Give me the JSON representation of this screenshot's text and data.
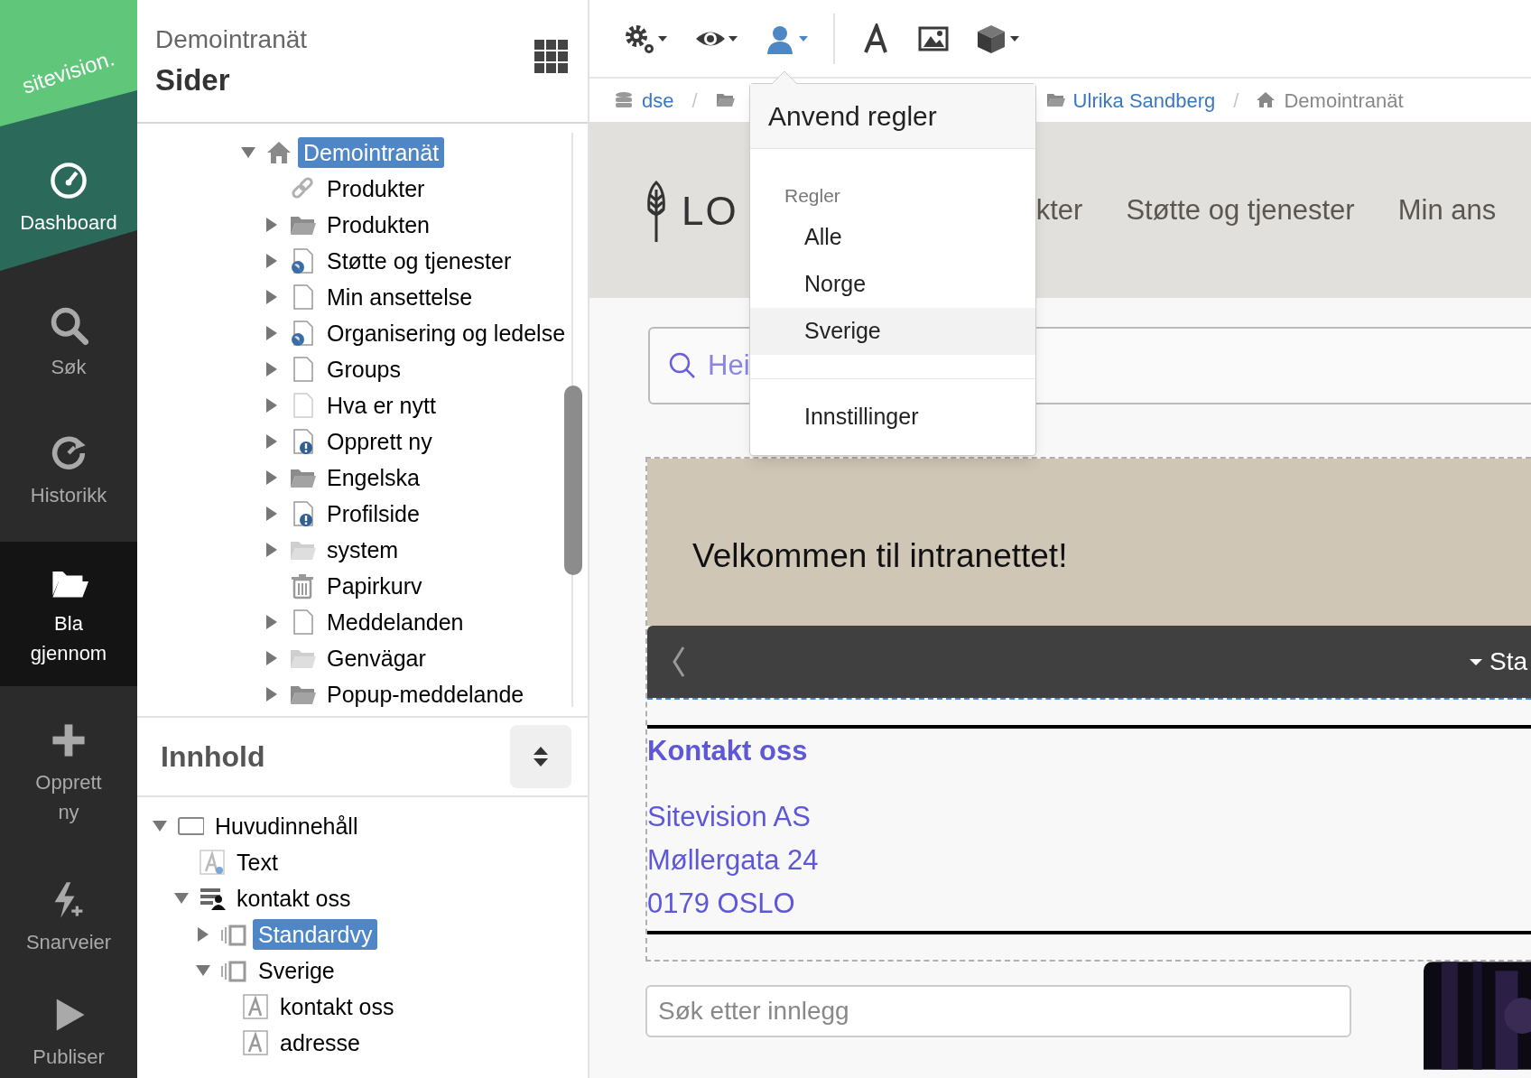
{
  "rail": {
    "logo": "sitevision.",
    "items": [
      {
        "label": "Dashboard",
        "selected": false
      },
      {
        "label": "Søk",
        "selected": false
      },
      {
        "label": "Historikk",
        "selected": false
      },
      {
        "label": "Bla gjennom",
        "selected": true
      },
      {
        "label": "Opprett ny",
        "selected": false
      },
      {
        "label": "Snarveier",
        "selected": false
      },
      {
        "label": "Publiser",
        "selected": false
      }
    ]
  },
  "pages_panel": {
    "site": "Demointranät",
    "title": "Sider",
    "tree": [
      {
        "label": "Demointranät",
        "kind": "home",
        "expanded": true,
        "selected": true,
        "children": [
          {
            "label": "Produkter",
            "kind": "link",
            "selected": false
          },
          {
            "label": "Produkten",
            "kind": "folder",
            "expanded": false,
            "selected": false
          },
          {
            "label": "Støtte og tjenester",
            "kind": "webpage",
            "expanded": false,
            "selected": false
          },
          {
            "label": "Min ansettelse",
            "kind": "page",
            "expanded": false,
            "selected": false
          },
          {
            "label": "Organisering og ledelse",
            "kind": "webpage",
            "expanded": false,
            "selected": false
          },
          {
            "label": "Groups",
            "kind": "page",
            "expanded": false,
            "selected": false
          },
          {
            "label": "Hva er nytt",
            "kind": "unpublished",
            "expanded": false,
            "selected": false
          },
          {
            "label": "Opprett ny",
            "kind": "alert",
            "expanded": false,
            "selected": false
          },
          {
            "label": "Engelska",
            "kind": "folder",
            "expanded": false,
            "selected": false
          },
          {
            "label": "Profilside",
            "kind": "alert",
            "expanded": false,
            "selected": false
          },
          {
            "label": "system",
            "kind": "archive",
            "expanded": false,
            "selected": false
          },
          {
            "label": "Papirkurv",
            "kind": "trash",
            "selected": false
          },
          {
            "label": "Meddelanden",
            "kind": "page",
            "expanded": false,
            "selected": false
          },
          {
            "label": "Genvägar",
            "kind": "archive",
            "expanded": false,
            "selected": false
          },
          {
            "label": "Popup-meddelande",
            "kind": "folder",
            "expanded": false,
            "selected": false
          }
        ]
      }
    ]
  },
  "content_panel": {
    "title": "Innhold",
    "tree": [
      {
        "label": "Huvudinnehåll",
        "kind": "area",
        "expanded": true,
        "selected": false,
        "children": [
          {
            "label": "Text",
            "kind": "newtext",
            "selected": false
          },
          {
            "label": "kontakt oss",
            "kind": "portlet",
            "expanded": true,
            "selected": false,
            "children": [
              {
                "label": "Standardvy",
                "kind": "view",
                "expanded": false,
                "selected": true
              },
              {
                "label": "Sverige",
                "kind": "view",
                "expanded": true,
                "selected": false,
                "children": [
                  {
                    "label": "kontakt oss",
                    "kind": "text",
                    "selected": false
                  },
                  {
                    "label": "adresse",
                    "kind": "text",
                    "selected": false
                  }
                ]
              }
            ]
          }
        ]
      }
    ]
  },
  "toolbar": [
    {
      "dropdown": true,
      "active": false
    },
    {
      "dropdown": true,
      "active": false
    },
    {
      "dropdown": true,
      "active": true
    },
    {
      "dropdown": false,
      "active": false
    },
    {
      "dropdown": false,
      "active": false
    },
    {
      "dropdown": true,
      "active": false
    }
  ],
  "breadcrumb": [
    {
      "label": "dse",
      "kind": "database",
      "link": true
    },
    {
      "kind": "folder"
    },
    {
      "label": "Ulrika Sandberg",
      "kind": "folder",
      "link": true,
      "separator": "/"
    },
    {
      "label": "Demointranät",
      "kind": "home",
      "link": false
    }
  ],
  "breadcrumb_separator": "/",
  "rules_menu": {
    "title": "Anvend regler",
    "group_label": "Regler",
    "items": [
      {
        "label": "Alle",
        "selected": false
      },
      {
        "label": "Norge",
        "selected": false
      },
      {
        "label": "Sverige",
        "selected": true
      }
    ],
    "settings": "Innstillinger"
  },
  "preview": {
    "logo_text": "LO",
    "nav": [
      "kter",
      "Støtte og tjenester",
      "Min ans"
    ],
    "search": {
      "placeholder": "Hei"
    },
    "banner": "Velkommen til intranettet!",
    "bar_label": "Sta",
    "contact": {
      "heading": "Kontakt oss",
      "lines": [
        "Sitevision AS",
        "Møllergata 24",
        "0179 OSLO"
      ]
    },
    "post_search": {
      "placeholder": "Søk etter innlegg"
    },
    "image": {
      "kind": "picture"
    }
  }
}
